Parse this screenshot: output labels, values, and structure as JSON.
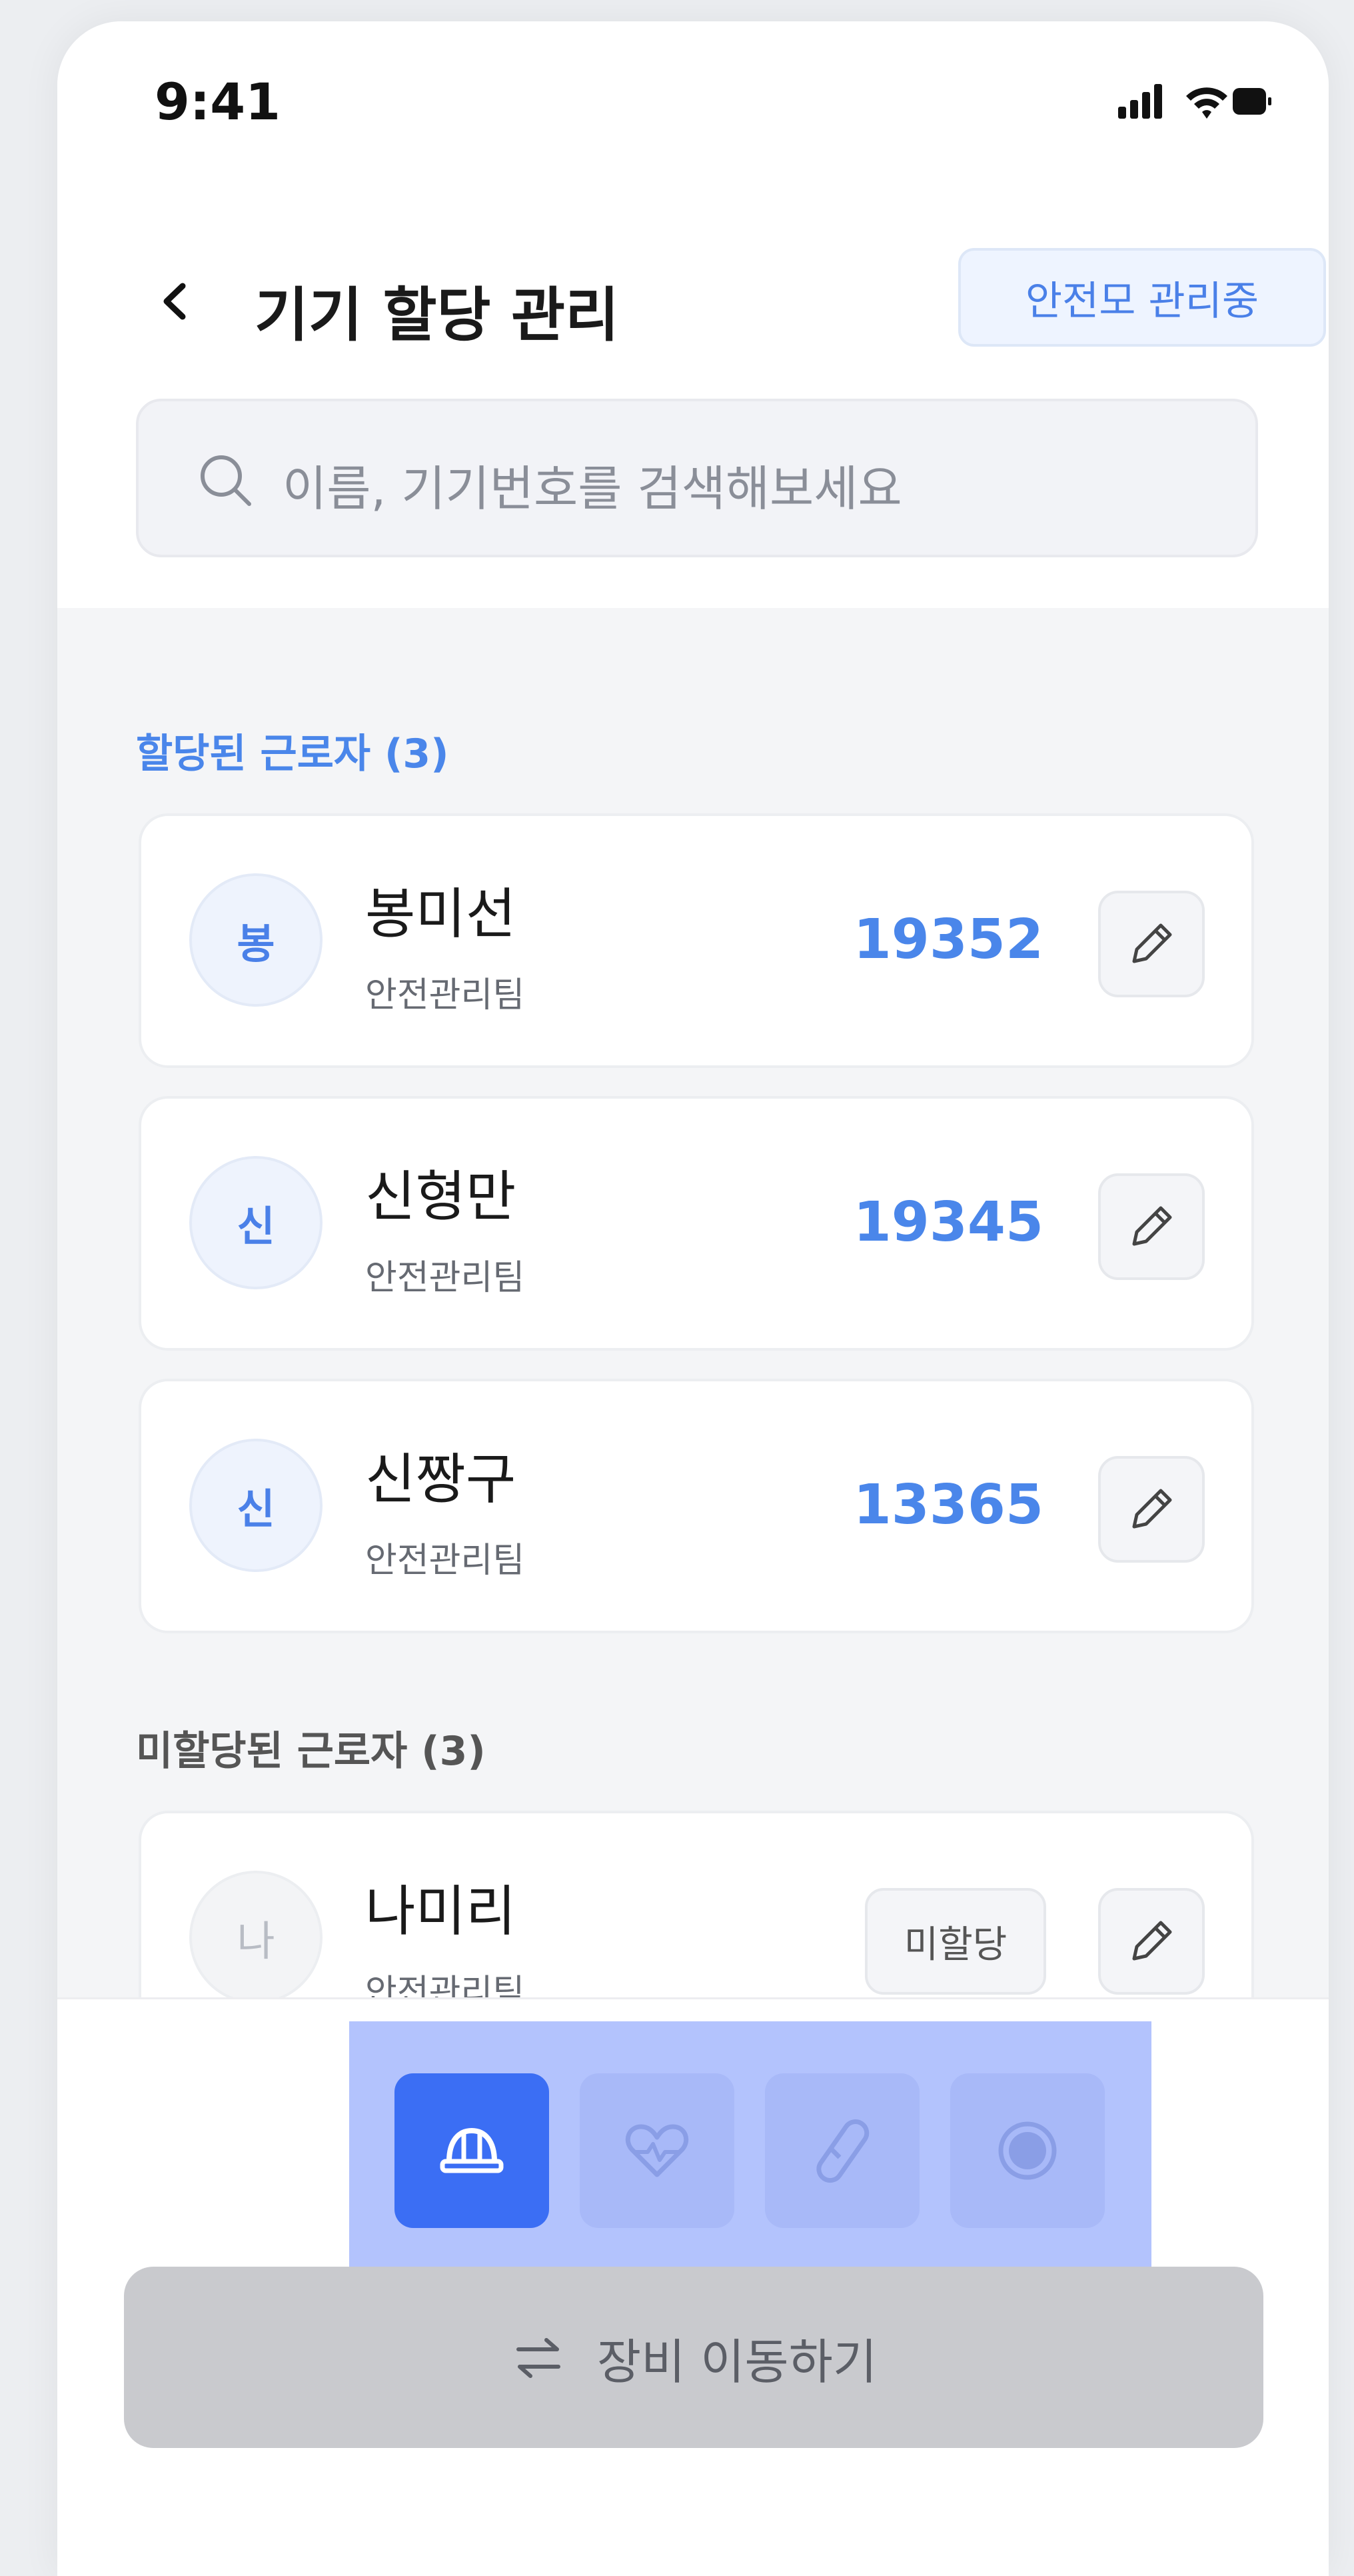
{
  "status_bar": {
    "time": "9:41"
  },
  "header": {
    "title": "기기 할당 관리",
    "badge": "안전모 관리중"
  },
  "search": {
    "placeholder": "이름, 기기번호를 검색해보세요"
  },
  "assigned": {
    "label": "할당된 근로자 (3)",
    "workers": [
      {
        "initial": "봉",
        "name": "봉미선",
        "team": "안전관리팀",
        "device": "19352"
      },
      {
        "initial": "신",
        "name": "신형만",
        "team": "안전관리팀",
        "device": "19345"
      },
      {
        "initial": "신",
        "name": "신짱구",
        "team": "안전관리팀",
        "device": "13365"
      }
    ]
  },
  "unassigned": {
    "label": "미할당된 근로자 (3)",
    "workers": [
      {
        "initial": "나",
        "name": "나미리",
        "team": "안전관리팀",
        "status": "미할당"
      }
    ]
  },
  "tabs": [
    {
      "icon": "helmet-icon",
      "active": true
    },
    {
      "icon": "heart-pulse-icon",
      "active": false
    },
    {
      "icon": "carabiner-icon",
      "active": false
    },
    {
      "icon": "record-icon",
      "active": false
    }
  ],
  "action": {
    "label": "장비 이동하기",
    "icon": "swap-arrows-icon"
  },
  "colors": {
    "accent": "#3b6ef4",
    "device_number": "#4a86ea",
    "badge_bg": "#eef4ff",
    "tab_bar_bg": "#b3c3fd",
    "disabled_button": "#c9cace"
  }
}
